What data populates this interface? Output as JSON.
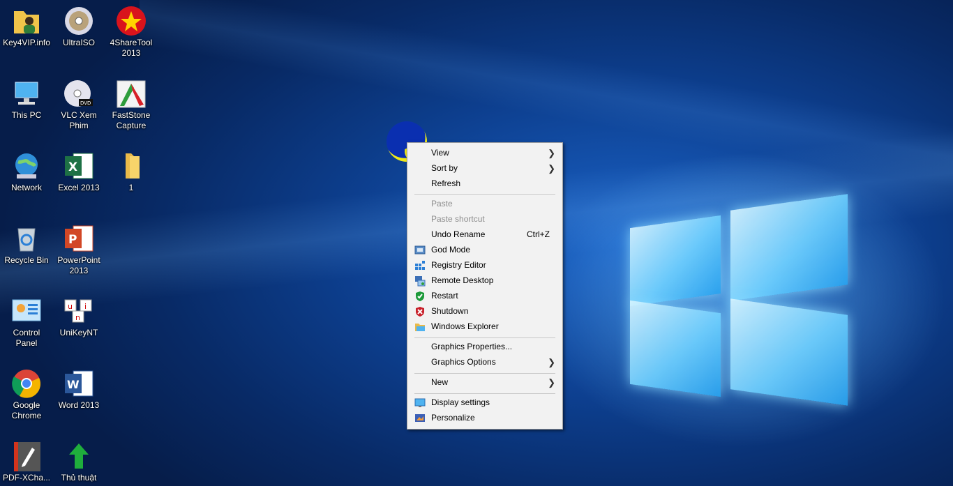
{
  "desktop_icons": [
    {
      "label": "Key4VIP.info",
      "icon": "folder-user-icon"
    },
    {
      "label": "UltraISO",
      "icon": "disc-icon"
    },
    {
      "label": "4ShareTool\n2013",
      "icon": "star-red-circle-icon"
    },
    {
      "label": "This PC",
      "icon": "computer-icon"
    },
    {
      "label": "VLC Xem\nPhim",
      "icon": "dvd-icon"
    },
    {
      "label": "FastStone\nCapture",
      "icon": "capture-icon"
    },
    {
      "label": "Network",
      "icon": "network-globe-icon"
    },
    {
      "label": "Excel 2013",
      "icon": "excel-icon"
    },
    {
      "label": "1",
      "icon": "folder-icon"
    },
    {
      "label": "Recycle Bin",
      "icon": "recycle-bin-icon"
    },
    {
      "label": "PowerPoint\n2013",
      "icon": "powerpoint-icon"
    },
    {
      "label": "Control\nPanel",
      "icon": "control-panel-icon"
    },
    {
      "label": "UniKeyNT",
      "icon": "unikey-icon"
    },
    {
      "label": "Google\nChrome",
      "icon": "chrome-icon"
    },
    {
      "label": "Word 2013",
      "icon": "word-icon"
    },
    {
      "label": "PDF-XCha...",
      "icon": "pdf-editor-icon"
    },
    {
      "label": "Thủ thuật",
      "icon": "green-arrow-icon"
    }
  ],
  "context_menu": {
    "items": [
      {
        "label": "View",
        "arrow": ">"
      },
      {
        "label": "Sort by",
        "arrow": ">"
      },
      {
        "label": "Refresh"
      },
      {
        "label": "Paste",
        "disabled": true
      },
      {
        "label": "Paste shortcut",
        "disabled": true
      },
      {
        "label": "Undo Rename",
        "shortcut": "Ctrl+Z"
      },
      {
        "label": "God Mode",
        "icon": "god-mode-icon"
      },
      {
        "label": "Registry Editor",
        "icon": "registry-icon"
      },
      {
        "label": "Remote Desktop",
        "icon": "remote-desktop-icon"
      },
      {
        "label": "Restart",
        "icon": "shield-green-icon"
      },
      {
        "label": "Shutdown",
        "icon": "shield-red-icon"
      },
      {
        "label": "Windows Explorer",
        "icon": "folder-icon"
      },
      {
        "label": "Graphics Properties..."
      },
      {
        "label": "Graphics Options",
        "arrow": ">"
      },
      {
        "label": "New",
        "arrow": ">"
      },
      {
        "label": "Display settings",
        "icon": "monitor-icon"
      },
      {
        "label": "Personalize",
        "icon": "personalize-icon"
      }
    ]
  }
}
